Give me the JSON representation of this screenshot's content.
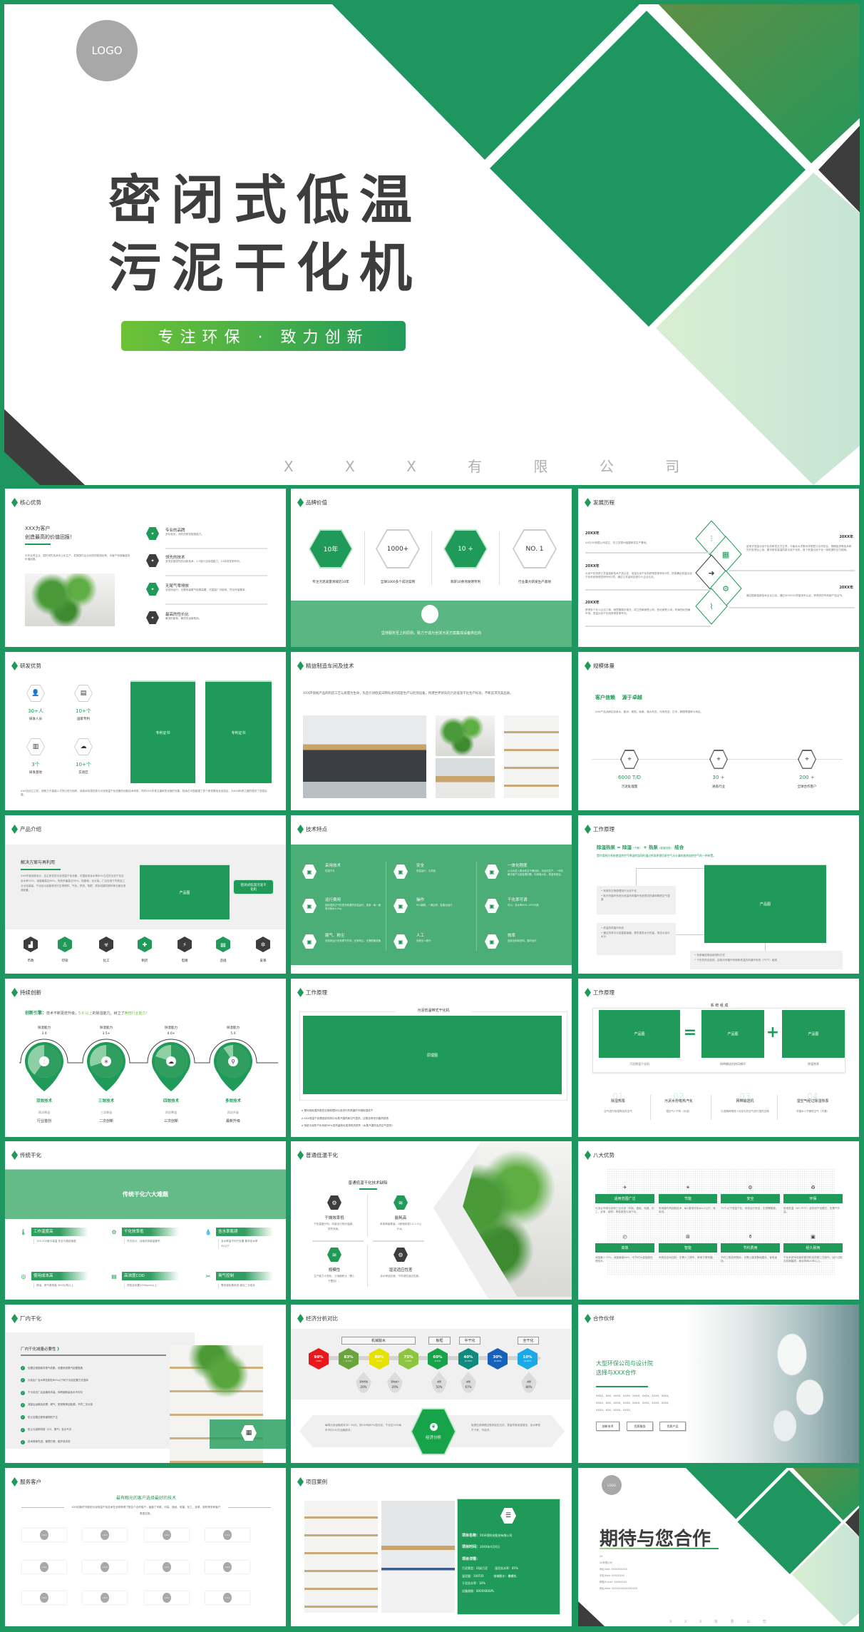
{
  "colors": {
    "frame": "#1e9660",
    "accent": "#1f9a58",
    "light_band": "#5ab682",
    "dark": "#3d3d3d"
  },
  "cover": {
    "logo": "LOGO",
    "title_line1": "密闭式低温",
    "title_line2": "污泥干化机",
    "tagline": "专注环保 · 致力创新",
    "company": "X X X 有 限 公 司"
  },
  "core": {
    "title": "核心优势",
    "headline1": "XXX为客户",
    "headline2": "创造最高的价值回报！",
    "body": "中外合资企业，国外领先技术本土化生产，发挥国内企业优质的制造优势，为客户创造最高的价值回报。",
    "items": [
      {
        "title": "专业的品牌",
        "desc": "多年真历，领先的研发制造能力。",
        "icon": "badge-icon"
      },
      {
        "title": "领先的技术",
        "desc": "多项全国领先的创新技术，1.5倍行业除湿能力，10余项发明专利。",
        "icon": "badge-icon"
      },
      {
        "title": "无尾气零排放",
        "desc": "全密闭运行，无需安装尾气除臭装置，可直接厂内使用，符合环保要求。",
        "icon": "badge-icon"
      },
      {
        "title": "最高的性价比",
        "desc": "最低的能耗，最低的运营费用。",
        "icon": "badge-icon"
      }
    ]
  },
  "brand": {
    "title": "品牌价值",
    "items": [
      {
        "value": "10年",
        "label": "专注污泥减量领域近10年",
        "filled": true
      },
      {
        "value": "1000+",
        "label": "全球1000多个成功案例",
        "filled": false
      },
      {
        "value": "10 +",
        "label": "荣获10余项发明专利",
        "filled": true
      },
      {
        "value": "NO. 1",
        "label": "行业最大研发生产基地",
        "filled": false
      }
    ],
    "slogan": "坚持服务至上的原则，致力于成为全球污泥方案集成设备供应商"
  },
  "history": {
    "title": "发展历程",
    "left": [
      {
        "year": "20XX年",
        "text": "XX与XX有限公司成立，在江苏泰州组建研发生产基地。"
      },
      {
        "year": "20XX年",
        "text": "污泥干化机获江苏省高新技术产品认定，低温污泥干化机获得发明专利X项，热泵耦合低温污泥干化系统获得发明专利1项，通过江苏省科技型中小企业认定。"
      },
      {
        "year": "20XX年",
        "text": "获得多个北斗企业订单，销售额稳步增长，成立西南销售公司，西北销售公司，布局西北西南市场，低温污泥干化机获得发明专利。"
      }
    ],
    "right": [
      {
        "year": "20XX年",
        "text": "密闭式低温污泥干化机研发正式立项，与南京大学泰州学院签订合作协议，首期投资等技术研究开发项目上线，着手研发高温热泵污泥干化机，首个低温污泥干化一体机顺利交付使用。"
      },
      {
        "year": "20XX年",
        "text": "通过国家高新技术企业认定，通过ISO9001质量体系认证，获得多项专利新产品证书。"
      }
    ]
  },
  "rnd": {
    "title": "研发优势",
    "stats": [
      {
        "value": "30+人",
        "label": "研发人员",
        "icon": "person-icon"
      },
      {
        "value": "10+个",
        "label": "国家专利",
        "icon": "certificate-icon"
      },
      {
        "value": "3个",
        "label": "研发基地",
        "icon": "building-icon"
      },
      {
        "value": "10+个",
        "label": "实验区",
        "icon": "flask-icon"
      }
    ],
    "cert1": "专利证书",
    "cert2": "专利证书",
    "body": "XXX自创立之初，就致力于高端人才的引进与培养，持续对除湿热泵与污泥低温干化设备的创新技术研发，同时XXX非常注重研发设施的完善，陆续在中国组建了多个研发基地及实验区，为XXX科研之路的提供了坚强后盾。"
  },
  "workshop": {
    "title": "精益制造车间及技术",
    "body": "XXX环保视产品的制造工艺与质量为生命，先后引进欧美日韩先进的成套生产与检测设备，构建世界领先的污泥低温干化生产标准，不断追求完美品质。"
  },
  "scale": {
    "title": "规模体量",
    "slogan1": "客户信赖",
    "slogan2": "源于卓越",
    "body": "XXX产品远销往加拿大、欧洲、美国、南美、澳大利亚、马来西亚、日本、韩国等国家与地区。",
    "stats": [
      {
        "value": "6000 T/D",
        "label": "污泥处理量"
      },
      {
        "value": "30 +",
        "label": "涵盖行业"
      },
      {
        "value": "200 +",
        "label": "全球合作客户"
      }
    ]
  },
  "product": {
    "title": "产品介绍",
    "subtitle": "解决方案与再利用",
    "body": "XXX环保创新设计，自主研发的污泥低温干化设备，可直接将含水率80%左右的污泥干化至含水率10%，减量最高达80%，有效杀菌高达90%，低能耗，无污染，广泛应用于市政及工业污泥减量。干化后污泥能够进行生物燃料、气化、掺烧、堆肥、焚烧或建材原料等无害化资源处置。",
    "image_label": "产品图",
    "callout": "密闭式低温污泥干化机",
    "industries": [
      {
        "label": "市政",
        "dark": true
      },
      {
        "label": "印染",
        "dark": false
      },
      {
        "label": "化工",
        "dark": true
      },
      {
        "label": "制药",
        "dark": false
      },
      {
        "label": "电镀",
        "dark": true
      },
      {
        "label": "造纸",
        "dark": false
      },
      {
        "label": "皮革",
        "dark": true
      }
    ]
  },
  "tech": {
    "title": "技术特点",
    "items": [
      {
        "title": "采用技术",
        "desc": "低温干化"
      },
      {
        "title": "安全",
        "desc": "低温运行，无风险"
      },
      {
        "title": "一体化程度",
        "desc": "从污水进入脱水机至干燥出料，均自动生产，一体化解决客户污泥处理问题，利润最大化，质量有保证。"
      },
      {
        "title": "运行费用",
        "desc": "回收湿热空气的显热和潜热低温运行，费用：每一度电可除水4.2kg"
      },
      {
        "title": "操作",
        "desc": "PLC编程，一键启停，智能化运行"
      },
      {
        "title": "干化率可调",
        "desc": "可以，含水率40%-10%可调"
      },
      {
        "title": "尾气、粉尘",
        "desc": "全密闭运行没有尾气外排，没有粉尘，无需配套设备"
      },
      {
        "title": "人工",
        "desc": "全程无人值守"
      },
      {
        "title": "效率",
        "desc": "连续出料和进料，循环运行"
      }
    ]
  },
  "principle1": {
    "title": "工作原理",
    "headline_a": "除湿热泵 = 除湿",
    "headline_a_note": "（干燥）",
    "headline_b": "+ 热泵",
    "headline_b_note": "（能量回收）",
    "headline_c": "结合",
    "sub": "是利用制冷系统使湿热空气降温除湿同时通过热泵原理回收空气水分凝结放热加热空气的一种装置。",
    "image_label": "产品图",
    "box1": [
      "采用热交换原理进行污泥干化",
      "制冷剂循环系统为低温热风循环系统提供热源和降低空气湿度"
    ],
    "box2": [
      "低温热风循环系统",
      "通过热风与污泥直接接触，提供蒸发水分热量，带走污泥中水分"
    ],
    "box3": [
      "采用输送带连续进料方式",
      "干化机完全密闭，由制冷剂循环系统和低温热风循环系统（75℃）组成"
    ]
  },
  "innovation": {
    "title": "持续创新",
    "lead_label": "创新引擎：",
    "lead_text1": "技术不断更迭升级，",
    "lead_hl1": "5.0 以上",
    "lead_text2": "的除湿能力，树立了",
    "lead_hl2": "两倍行业能力！",
    "stages": [
      {
        "caption": "除湿能力",
        "value": "3.0",
        "name": "双效技术",
        "sub": "两次降温",
        "note": "行业首创",
        "icon": "sliders-icon",
        "level": 0.6
      },
      {
        "caption": "除湿能力",
        "value": "3.5+",
        "name": "三效技术",
        "sub": "三次降温",
        "note": "二次创新",
        "icon": "snowflake-icon",
        "level": 0.7
      },
      {
        "caption": "除湿能力",
        "value": "4.0+",
        "name": "四效技术",
        "sub": "四次降温",
        "note": "三次创新",
        "icon": "cloud-icon",
        "level": 0.8
      },
      {
        "caption": "除湿能力",
        "value": "5.0",
        "name": "多效技术",
        "sub": "再次升级",
        "note": "最新升级",
        "icon": "rocket-icon",
        "level": 0.9
      }
    ]
  },
  "principle2": {
    "title": "工作原理",
    "frame_title": "污泥低温带式干化机",
    "image_label": "原理图",
    "bullets": [
      "是利用除湿热泵热交换原理对污泥进行热风循环冷凝除湿烘干",
      "XXX低温干化是回收排风中水蒸汽潜热和空气显热，过程没有任何废热排放",
      "传统污泥热干化系统90%供热量转化成排风热损失（水蒸汽潜热及热空气显热）"
    ]
  },
  "principle3": {
    "title": "工作原理",
    "frame_title": "系 统 组 成",
    "equals": "=",
    "plus": "+",
    "parts": [
      {
        "image": "产品图",
        "label": "污泥除湿干化机"
      },
      {
        "image": "产品图",
        "label": "网带输送机热风循环"
      },
      {
        "image": "产品图",
        "label": "除湿热泵"
      }
    ],
    "steps": [
      {
        "num": "01",
        "title": "除湿热泵",
        "desc": "空气进行除湿再加热空气"
      },
      {
        "num": "02",
        "title": "污泥水份吸热汽化",
        "desc": "湿空气+干料（污泥）"
      },
      {
        "num": "03",
        "title": "网带输送机",
        "desc": "污泥随网带进+污泥与热空气进行湿热交换"
      },
      {
        "num": "04",
        "title": "湿空气经过除湿热泵",
        "desc": "冷凝水+干燥热空气（冷凝）"
      }
    ]
  },
  "traditional": {
    "title": "传统干化",
    "banner": "传统干化六大难题",
    "items": [
      {
        "title": "工作温度高",
        "desc": "150-300度中高温 安全与稳定隐患",
        "icon": "thermometer-icon"
      },
      {
        "title": "干化效率低",
        "desc": "开式设计，持续热风能量散失",
        "icon": "gear-icon"
      },
      {
        "title": "含水率瓶颈",
        "desc": "含水率高不利于处置 要求含水率35以下",
        "icon": "droplet-icon"
      },
      {
        "title": "使用成本高",
        "desc": "燃油、燃气费用高 300元/吨以上",
        "icon": "coin-icon"
      },
      {
        "title": "高浓度COD",
        "desc": "排放及处置2000ppm以上",
        "icon": "layers-icon"
      },
      {
        "title": "臭气控制",
        "desc": "需安装除臭系统 增加二次成本",
        "icon": "tools-icon"
      }
    ]
  },
  "normal": {
    "title": "普通低温干化",
    "subtitle": "普通低温干化技术缺陷",
    "items": [
      {
        "title": "干燥效率低",
        "desc": "干化温度分布、风量设计相对温度、损失利用。",
        "dark": true
      },
      {
        "title": "能耗高",
        "desc": "采用单级蒸馏，1度电除湿1.0-1.5公斤水。",
        "dark": false
      },
      {
        "title": "规模性",
        "desc": "生产能力小型化、占地面积大（需上下叠加）。",
        "dark": false
      },
      {
        "title": "湿泥适应性差",
        "desc": "含水率适应差、不同泥性适应性差。",
        "dark": true
      }
    ]
  },
  "eight": {
    "title": "八大优势",
    "items": [
      {
        "title": "适用范围广泛",
        "desc": "可适合市政污泥和工业污泥（印染、造纸、电镀、化工、皮革、制药）等各类型污泥干化。"
      },
      {
        "title": "节能",
        "desc": "采用循环风回收技术，每1度电可除水4.2公斤，耗电低。"
      },
      {
        "title": "安全",
        "desc": "70℃以下低温干化，系统运行安全，无燃爆隐患。"
      },
      {
        "title": "环保",
        "desc": "采用低温（40-75℃）全封闭干化模式，无臭气外溢。"
      },
      {
        "title": "高效",
        "desc": "减量最少70%，减量最高80%，可节约大量固废处理成本。"
      },
      {
        "title": "智能",
        "desc": "系统全自动控制，无需人工操作，简单方便快捷。"
      },
      {
        "title": "节约费用",
        "desc": "节约工程投资费用，无需土建或基础建设，省电省钱。"
      },
      {
        "title": "经久耐用",
        "desc": "干化系统采用高耐腐材料及防腐工艺制作，运行过程无机械磨损，使用寿命20年以上。"
      }
    ]
  },
  "inplant": {
    "title": "厂内干化",
    "subtitle": "厂内干化减量必要性",
    "chevron": "》",
    "checks": [
      "处置过程能耗异臭气收集，设置系统臭气处置措施",
      "污泥出厂含水率控制在80%以下利于污泥处置方式选择",
      "干污泥出厂后运输成本高，体积细粉高含水不均匀",
      "减量后运输及处理、燃气、焚烧等清洁能源，不同二次污染",
      "防止处置过程有害物的产生",
      "防止污染物排放（CO、臭气）至大气中",
      "技术简单先进，管理方便，维护成本低"
    ]
  },
  "economy": {
    "title": "经济分析对比",
    "groups": [
      "机械脱水",
      "板框",
      "半干化",
      "全干化"
    ],
    "stages": [
      {
        "pct": "98%",
        "mass": "(10T)",
        "color": "#e8191c"
      },
      {
        "pct": "83%",
        "mass": "(1.2T)",
        "color": "#6aa43c"
      },
      {
        "pct": "80%",
        "mass": "(1.0T)",
        "color": "#e6e200"
      },
      {
        "pct": "75%",
        "mass": "(0.8T)",
        "color": "#8cc63f"
      },
      {
        "pct": "60%",
        "mass": "(0.5T)",
        "color": "#17a34a"
      },
      {
        "pct": "40%",
        "mass": "(0.33T)",
        "color": "#0f8a7c"
      },
      {
        "pct": "30%",
        "mass": "(0.29T)",
        "color": "#1762b8"
      },
      {
        "pct": "10%",
        "mass": "(0.22T)",
        "color": "#1aa9e6"
      }
    ],
    "drops": [
      {
        "label": "泥饼增加",
        "value": "20%"
      },
      {
        "label": "泥饼减少",
        "value": "20%"
      },
      {
        "label": "减量",
        "value": "50%"
      },
      {
        "label": "减量",
        "value": "67%"
      },
      {
        "label": "减量",
        "value": "80%"
      }
    ],
    "center": "经济分析",
    "left_text": "每吨污泥运输成本30~40元，按100吨80%湿污泥，干化至10%每年节约130万运输成本。",
    "right_text": "板框压滤调理过程添加生石灰、铁盐导致泥量增加，含水率低不下来，不经济。"
  },
  "partners": {
    "title": "合作伙伴",
    "headline1": "大型环保公司与设计院",
    "headline2": "选择与XXX合作",
    "lines": [
      "XXXX、XXX、XXXX、XXXX、XXXX、XXXX、XXXX、XXXX、",
      "XXXX、XXX、XXXX、XXXX、XXXX、XXXX、XXXX、XXXX、",
      "XXXX、XXX、XXXX、XXXX、"
    ],
    "buttons": [
      "创新技术",
      "优质服务",
      "优质产品"
    ]
  },
  "clients": {
    "title": "服务客户",
    "headline": "最有眼光的客户选择最好的技术",
    "body": "XXX创新的节能型污泥低温干化技术在全球获得了数百个合作客户，涵盖了市政、印染、造纸、电镀、化工、皮革、制药等多种客户类型应用。",
    "logo": "LOGO"
  },
  "case": {
    "title": "项目案例",
    "name_label": "项目名称：",
    "name": "XX环保科技股份有限公司",
    "time_label": "项目时间：",
    "time": "20XX年X月X日",
    "detail_label": "项目详情：",
    "type": "污泥类型：印染污泥",
    "wet_water": "湿泥含水率：85%",
    "amount": "湿泥量：100T/D",
    "dewater": "前端脱水：叠螺机",
    "dry_water": "干泥含水率：30%",
    "spec": "设备规格：8000X800PL"
  },
  "closing": {
    "logo": "LOGO",
    "title": "期待与您合作",
    "lines": [
      "XX",
      "XX有限公司",
      "地址/Add: XXXXXXXXXX",
      "手机/Mob: XXXXXXXX",
      "邮箱/E-mail: XXXXXXXX",
      "网址/Web: XXXXXXXXXXXXXXXX"
    ],
    "company": "X X X 有 限 公 司"
  }
}
